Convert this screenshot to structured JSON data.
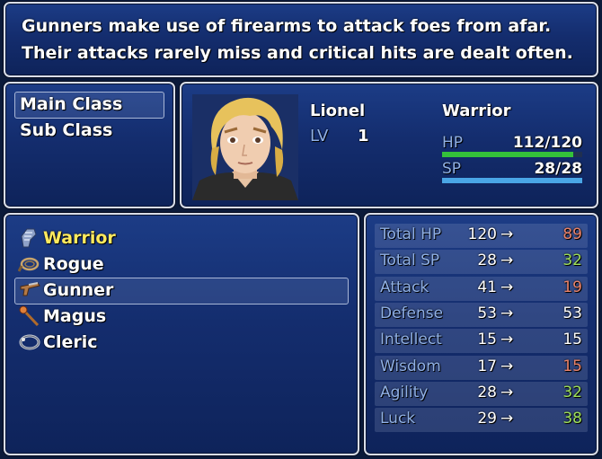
{
  "help": {
    "line1": "Gunners make use of firearms to attack foes from afar.",
    "line2": "Their attacks rarely miss and critical hits are dealt often."
  },
  "class_menu": {
    "items": [
      "Main Class",
      "Sub Class"
    ],
    "selected_index": 0
  },
  "actor": {
    "name": "Lionel",
    "level_label": "LV",
    "level": "1",
    "class": "Warrior",
    "hp_label": "HP",
    "hp": "112/120",
    "hp_fraction": 0.933,
    "sp_label": "SP",
    "sp": "28/28",
    "sp_fraction": 1.0,
    "hp_color": "#34c23a",
    "sp_color": "#4aa6e6"
  },
  "class_list": {
    "items": [
      {
        "label": "Warrior",
        "icon": "gauntlet-icon",
        "highlight": true
      },
      {
        "label": "Rogue",
        "icon": "whip-icon",
        "highlight": false
      },
      {
        "label": "Gunner",
        "icon": "gun-icon",
        "highlight": false
      },
      {
        "label": "Magus",
        "icon": "staff-icon",
        "highlight": false
      },
      {
        "label": "Cleric",
        "icon": "ring-icon",
        "highlight": false
      }
    ],
    "selected_index": 2,
    "highlight_color": "#ffea5e"
  },
  "params": {
    "arrow": "→",
    "rows": [
      {
        "name": "Total HP",
        "current": "120",
        "new": "89",
        "change": "down"
      },
      {
        "name": "Total SP",
        "current": "28",
        "new": "32",
        "change": "up"
      },
      {
        "name": "Attack",
        "current": "41",
        "new": "19",
        "change": "down"
      },
      {
        "name": "Defense",
        "current": "53",
        "new": "53",
        "change": "same"
      },
      {
        "name": "Intellect",
        "current": "15",
        "new": "15",
        "change": "same"
      },
      {
        "name": "Wisdom",
        "current": "17",
        "new": "15",
        "change": "down"
      },
      {
        "name": "Agility",
        "current": "28",
        "new": "32",
        "change": "up"
      },
      {
        "name": "Luck",
        "current": "29",
        "new": "38",
        "change": "up"
      }
    ],
    "colors": {
      "up": "#9ee05a",
      "down": "#e8826a",
      "same": "#ffffff"
    }
  }
}
